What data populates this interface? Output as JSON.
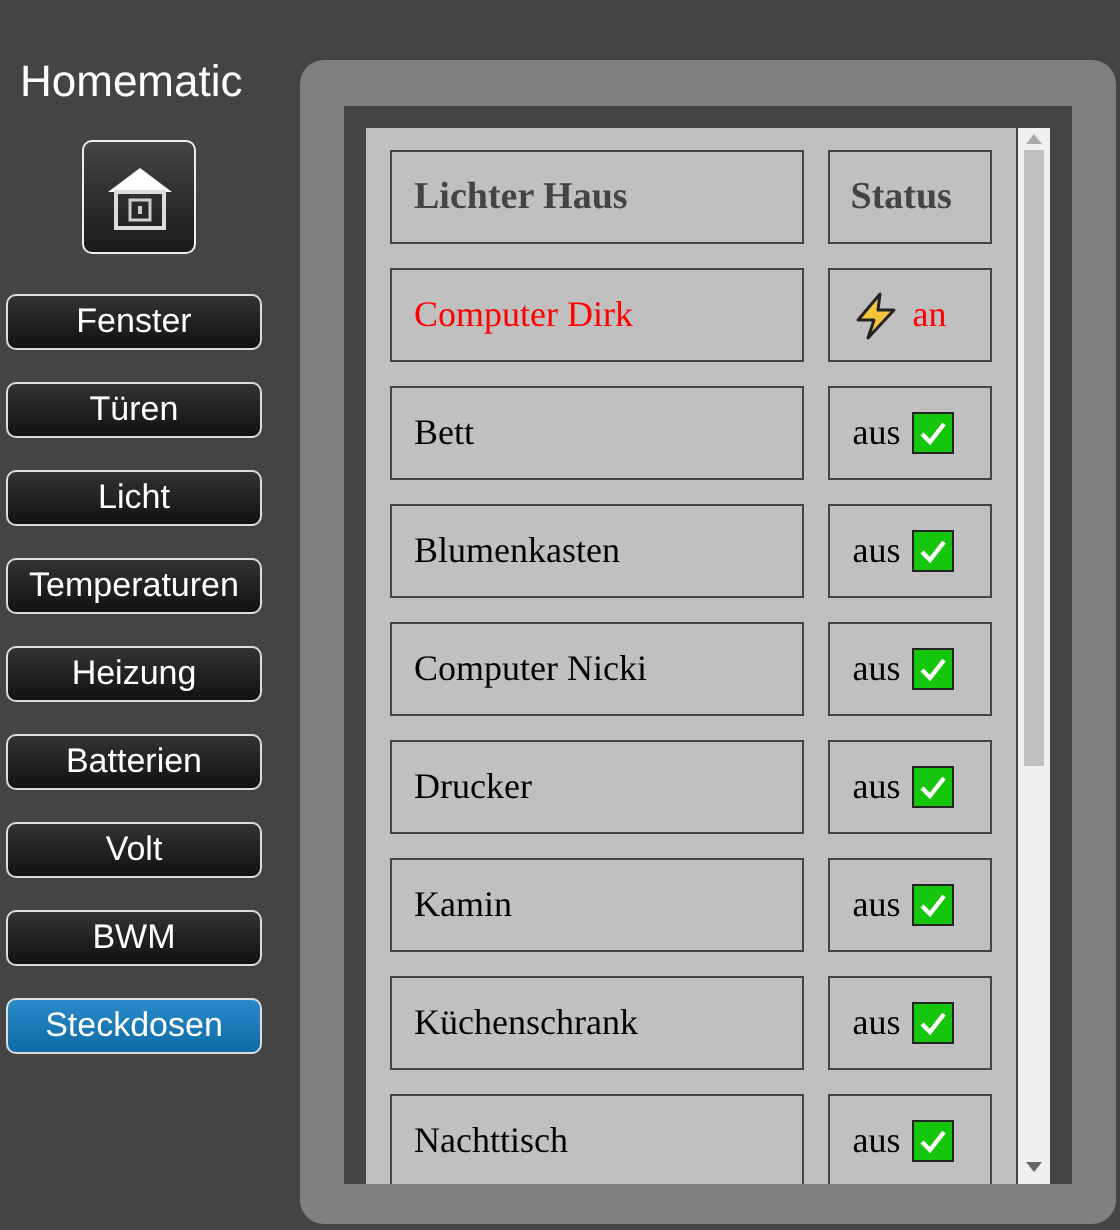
{
  "sidebar": {
    "title": "Homematic",
    "items": [
      {
        "label": "Fenster",
        "selected": false
      },
      {
        "label": "Türen",
        "selected": false
      },
      {
        "label": "Licht",
        "selected": false
      },
      {
        "label": "Temperaturen",
        "selected": false
      },
      {
        "label": "Heizung",
        "selected": false
      },
      {
        "label": "Batterien",
        "selected": false
      },
      {
        "label": "Volt",
        "selected": false
      },
      {
        "label": "BWM",
        "selected": false
      },
      {
        "label": "Steckdosen",
        "selected": true
      }
    ]
  },
  "table": {
    "columns": [
      "Lichter Haus",
      "Status"
    ],
    "rows": [
      {
        "name": "Computer Dirk",
        "status": "an",
        "on": true
      },
      {
        "name": "Bett",
        "status": "aus",
        "on": false
      },
      {
        "name": "Blumenkasten",
        "status": "aus",
        "on": false
      },
      {
        "name": "Computer Nicki",
        "status": "aus",
        "on": false
      },
      {
        "name": "Drucker",
        "status": "aus",
        "on": false
      },
      {
        "name": "Kamin",
        "status": "aus",
        "on": false
      },
      {
        "name": "Küchenschrank",
        "status": "aus",
        "on": false
      },
      {
        "name": "Nachttisch",
        "status": "aus",
        "on": false
      }
    ]
  }
}
